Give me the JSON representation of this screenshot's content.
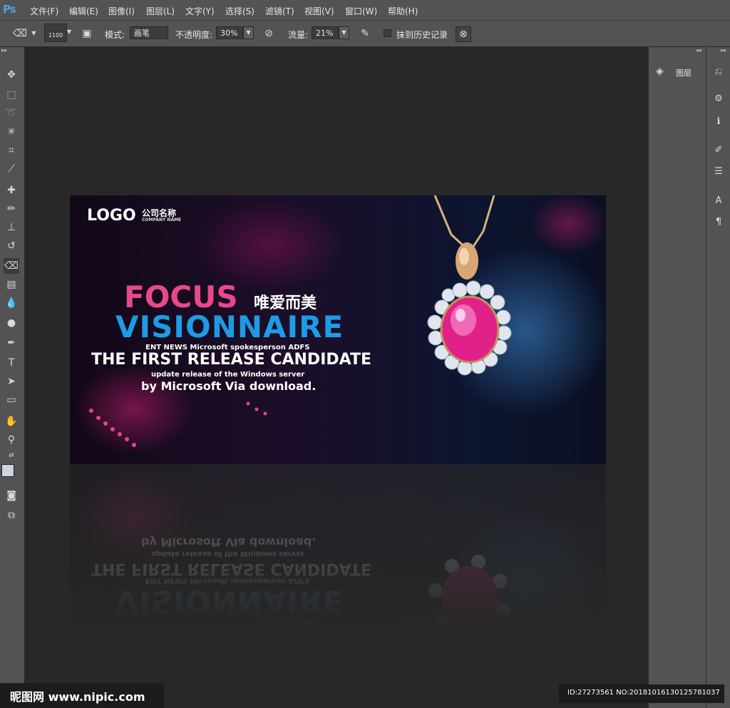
{
  "app": {
    "logo": "Ps"
  },
  "menu": [
    "文件(F)",
    "编辑(E)",
    "图像(I)",
    "图层(L)",
    "文字(Y)",
    "选择(S)",
    "滤镜(T)",
    "视图(V)",
    "窗口(W)",
    "帮助(H)"
  ],
  "options_bar": {
    "brush_size": "1100",
    "mode_label": "模式:",
    "mode_value": "画笔",
    "opacity_label": "不透明度:",
    "opacity_value": "30%",
    "flow_label": "流量:",
    "flow_value": "21%",
    "erase_history_label": "抹到历史记录"
  },
  "panels": {
    "layers_label": "图层"
  },
  "artwork": {
    "logo": "LOGO",
    "logo_cn": "公司名称",
    "logo_en": "COMPANY NAME",
    "headline1": "FOCUS",
    "headline_cn": "唯爱而美",
    "headline2": "VISIONNAIRE",
    "line1": "ENT NEWS Microsoft spokesperson ADFS",
    "line2": "THE FIRST RELEASE CANDIDATE",
    "line3": "update release of the Windows server",
    "line4": "by Microsoft Via download.",
    "colors": {
      "focus": "#e8488c",
      "visionnaire": "#1e9be4"
    }
  },
  "watermark": {
    "site": "昵图网 www.nipic.com",
    "id": "ID:27273561 NO:20181016130125781037"
  }
}
